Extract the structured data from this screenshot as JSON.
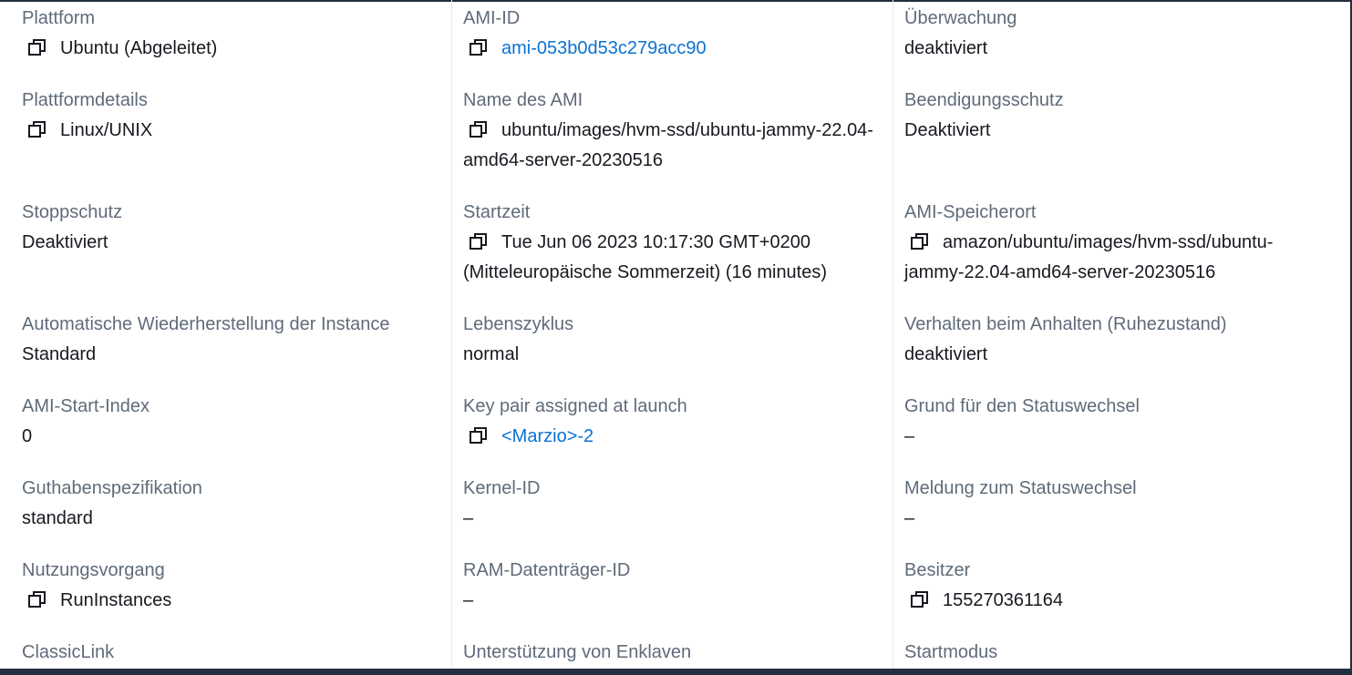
{
  "columns": [
    {
      "fields": [
        {
          "label": "Plattform",
          "value": "Ubuntu (Abgeleitet)",
          "copy": true,
          "link": false
        },
        {
          "label": "Plattformdetails",
          "value": "Linux/UNIX",
          "copy": true,
          "link": false
        },
        {
          "label": "Stoppschutz",
          "value": "Deaktiviert",
          "copy": false,
          "link": false
        },
        {
          "label": "Automatische Wiederherstellung der Instance",
          "value": "Standard",
          "copy": false,
          "link": false
        },
        {
          "label": "AMI-Start-Index",
          "value": "0",
          "copy": false,
          "link": false
        },
        {
          "label": "Guthabenspezifikation",
          "value": "standard",
          "copy": false,
          "link": false
        },
        {
          "label": "Nutzungsvorgang",
          "value": "RunInstances",
          "copy": true,
          "link": false
        },
        {
          "label": "ClassicLink",
          "value": "",
          "copy": false,
          "link": false
        }
      ]
    },
    {
      "fields": [
        {
          "label": "AMI-ID",
          "value": "ami-053b0d53c279acc90",
          "copy": true,
          "link": true
        },
        {
          "label": "Name des AMI",
          "value": "ubuntu/images/hvm-ssd/ubuntu-jammy-22.04-amd64-server-20230516",
          "copy": true,
          "link": false
        },
        {
          "label": "Startzeit",
          "value": "Tue Jun 06 2023 10:17:30 GMT+0200 (Mitteleuropäische Sommerzeit) (16 minutes)",
          "copy": true,
          "link": false
        },
        {
          "label": "Lebenszyklus",
          "value": "normal",
          "copy": false,
          "link": false
        },
        {
          "label": "Key pair assigned at launch",
          "value": "<Marzio>-2",
          "copy": true,
          "link": true
        },
        {
          "label": "Kernel-ID",
          "value": "–",
          "copy": false,
          "link": false
        },
        {
          "label": "RAM-Datenträger-ID",
          "value": "–",
          "copy": false,
          "link": false
        },
        {
          "label": "Unterstützung von Enklaven",
          "value": "",
          "copy": false,
          "link": false
        }
      ]
    },
    {
      "fields": [
        {
          "label": "Überwachung",
          "value": "deaktiviert",
          "copy": false,
          "link": false
        },
        {
          "label": "Beendigungsschutz",
          "value": "Deaktiviert",
          "copy": false,
          "link": false
        },
        {
          "label": "AMI-Speicherort",
          "value": "amazon/ubuntu/images/hvm-ssd/ubuntu-jammy-22.04-amd64-server-20230516",
          "copy": true,
          "link": false
        },
        {
          "label": "Verhalten beim Anhalten (Ruhezustand)",
          "value": "deaktiviert",
          "copy": false,
          "link": false
        },
        {
          "label": "Grund für den Statuswechsel",
          "value": "–",
          "copy": false,
          "link": false
        },
        {
          "label": "Meldung zum Statuswechsel",
          "value": "–",
          "copy": false,
          "link": false
        },
        {
          "label": "Besitzer",
          "value": "155270361164",
          "copy": true,
          "link": false
        },
        {
          "label": "Startmodus",
          "value": "",
          "copy": false,
          "link": false
        }
      ]
    }
  ],
  "colors": {
    "label": "#5f6b7a",
    "value": "#16191f",
    "link": "#0972d3",
    "border": "#232f3e"
  },
  "icons": {
    "copy": "copy-icon"
  }
}
